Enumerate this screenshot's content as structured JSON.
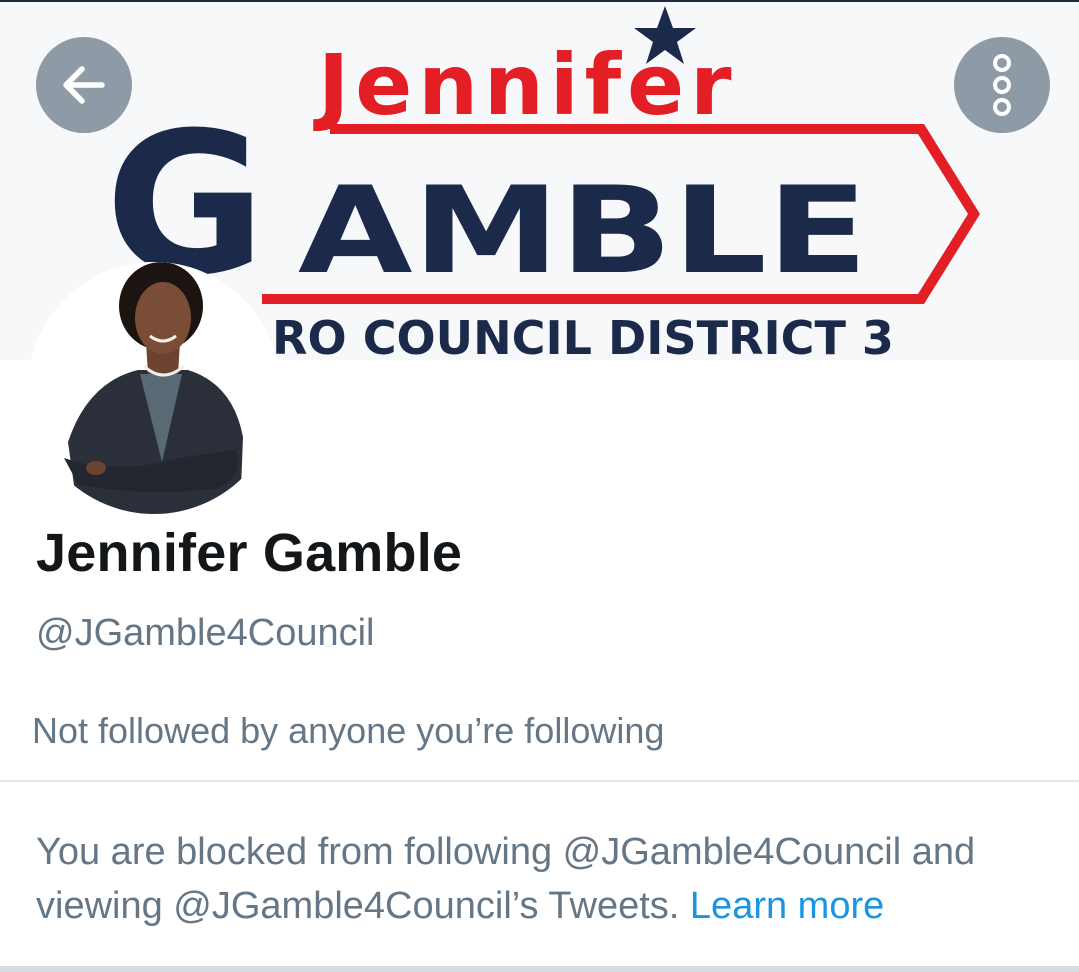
{
  "banner": {
    "first_name": "Jennifer",
    "last_name_initial": "G",
    "last_name_rest": "AMBLE",
    "tagline": "RO COUNCIL DISTRICT 3",
    "colors": {
      "navy": "#1b2a4a",
      "red": "#e31e24",
      "background": "#f7f8f9"
    }
  },
  "header": {
    "back_icon": "arrow-left-icon",
    "more_icon": "more-vertical-icon"
  },
  "profile": {
    "display_name": "Jennifer Gamble",
    "handle": "@JGamble4Council",
    "followed_by": "Not followed by anyone you’re following"
  },
  "blocked": {
    "message": "You are blocked from following @JGamble4Council and viewing @JGamble4Council’s Tweets.",
    "learn_more": "Learn more"
  },
  "colors": {
    "primary_text": "#14171a",
    "secondary_text": "#657786",
    "link": "#1b95e0",
    "divider": "#e1e8ed"
  }
}
